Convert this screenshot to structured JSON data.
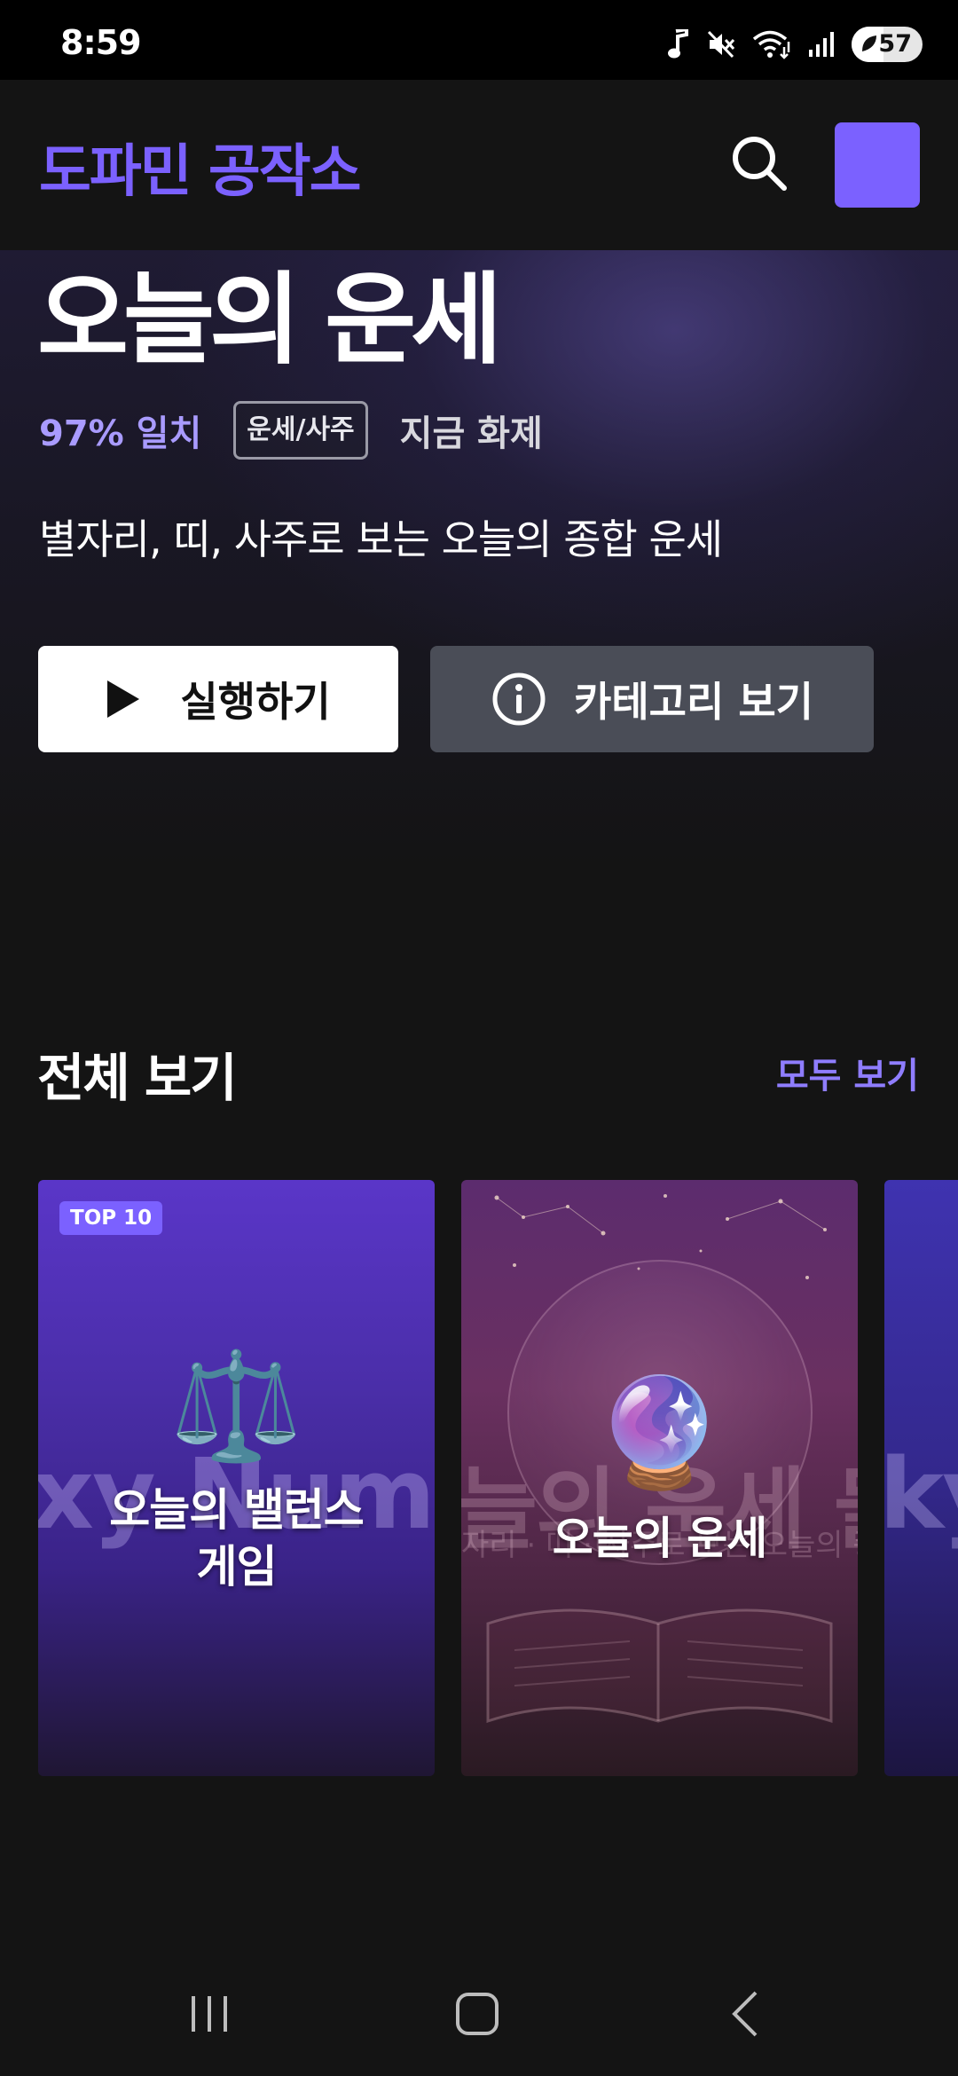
{
  "status_bar": {
    "time": "8:59",
    "battery_level": "57",
    "icons": [
      "music-note-icon",
      "mute-icon",
      "wifi-icon",
      "signal-icon",
      "battery-icon"
    ]
  },
  "header": {
    "app_title": "도파민 공작소",
    "search_icon": "search-icon",
    "accent_color": "#7b61ff"
  },
  "hero": {
    "title": "오늘의 운세",
    "match_score": "97% 일치",
    "category_badge": "운세/사주",
    "trending_label": "지금 화제",
    "description": "별자리, 띠, 사주로 보는 오늘의 종합 운세",
    "run_button_label": "실행하기",
    "category_button_label": "카테고리 보기"
  },
  "section": {
    "title": "전체 보기",
    "see_all_label": "모두 보기"
  },
  "cards": [
    {
      "badge": "TOP 10",
      "bg_text": "xy Num",
      "emoji": "⚖️",
      "title": "오늘의 밸런스\n게임"
    },
    {
      "bg_text": "늘의 운세 둘",
      "bg_text_small": "자리 · 띠 · 사주로 보는 오늘의 종합 운",
      "emoji": "🔮",
      "title": "오늘의 운세"
    },
    {
      "bg_text": "ky"
    }
  ],
  "nav_bar": {
    "icons": [
      "recent-apps-icon",
      "home-icon",
      "back-icon"
    ]
  }
}
